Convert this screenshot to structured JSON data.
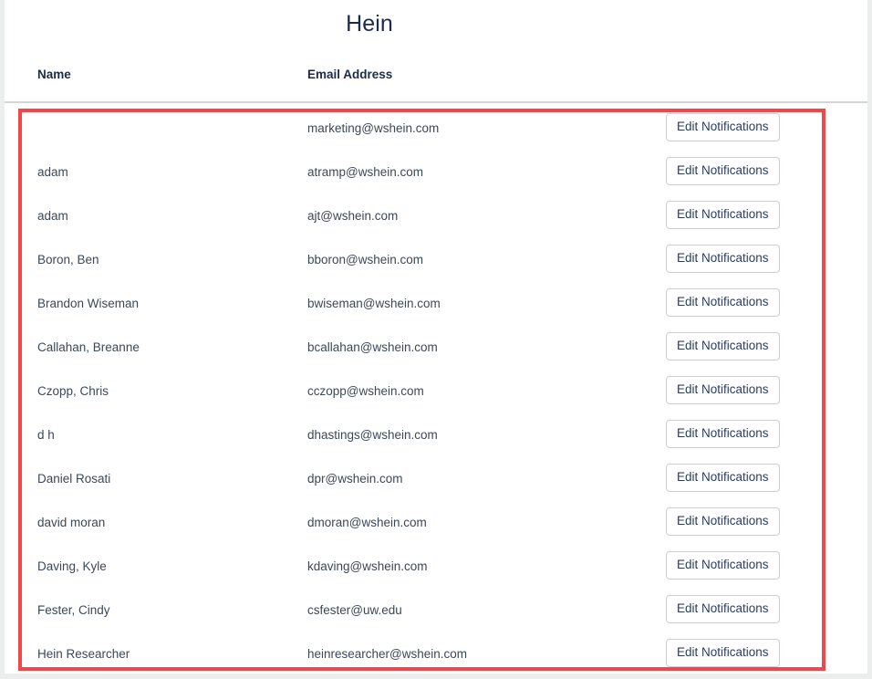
{
  "page": {
    "title": "Hein"
  },
  "table": {
    "columns": [
      {
        "key": "name",
        "label": "Name"
      },
      {
        "key": "email",
        "label": "Email Address"
      }
    ],
    "action_label": "Edit Notifications",
    "rows": [
      {
        "name": "",
        "email": "marketing@wshein.com",
        "action": "Edit Notifications"
      },
      {
        "name": "adam",
        "email": "atramp@wshein.com",
        "action": "Edit Notifications"
      },
      {
        "name": "adam",
        "email": "ajt@wshein.com",
        "action": "Edit Notifications"
      },
      {
        "name": "Boron, Ben",
        "email": "bboron@wshein.com",
        "action": "Edit Notifications"
      },
      {
        "name": "Brandon Wiseman",
        "email": "bwiseman@wshein.com",
        "action": "Edit Notifications"
      },
      {
        "name": "Callahan, Breanne",
        "email": "bcallahan@wshein.com",
        "action": "Edit Notifications"
      },
      {
        "name": "Czopp, Chris",
        "email": "cczopp@wshein.com",
        "action": "Edit Notifications"
      },
      {
        "name": "d h",
        "email": "dhastings@wshein.com",
        "action": "Edit Notifications"
      },
      {
        "name": "Daniel Rosati",
        "email": "dpr@wshein.com",
        "action": "Edit Notifications"
      },
      {
        "name": "david moran",
        "email": "dmoran@wshein.com",
        "action": "Edit Notifications"
      },
      {
        "name": "Daving, Kyle",
        "email": "kdaving@wshein.com",
        "action": "Edit Notifications"
      },
      {
        "name": "Fester, Cindy",
        "email": "csfester@uw.edu",
        "action": "Edit Notifications"
      },
      {
        "name": "Hein Researcher",
        "email": "heinresearcher@wshein.com",
        "action": "Edit Notifications"
      }
    ]
  },
  "annotation": {
    "highlight_color": "#f4464a"
  },
  "colors": {
    "page_background": "#ffffff",
    "canvas_background": "#eceded",
    "text_primary": "#3c4858",
    "text_heading": "#1b2b4b",
    "button_text": "#2a3d63",
    "button_border": "#cdd0d4",
    "header_rule": "#d3d5d7"
  }
}
